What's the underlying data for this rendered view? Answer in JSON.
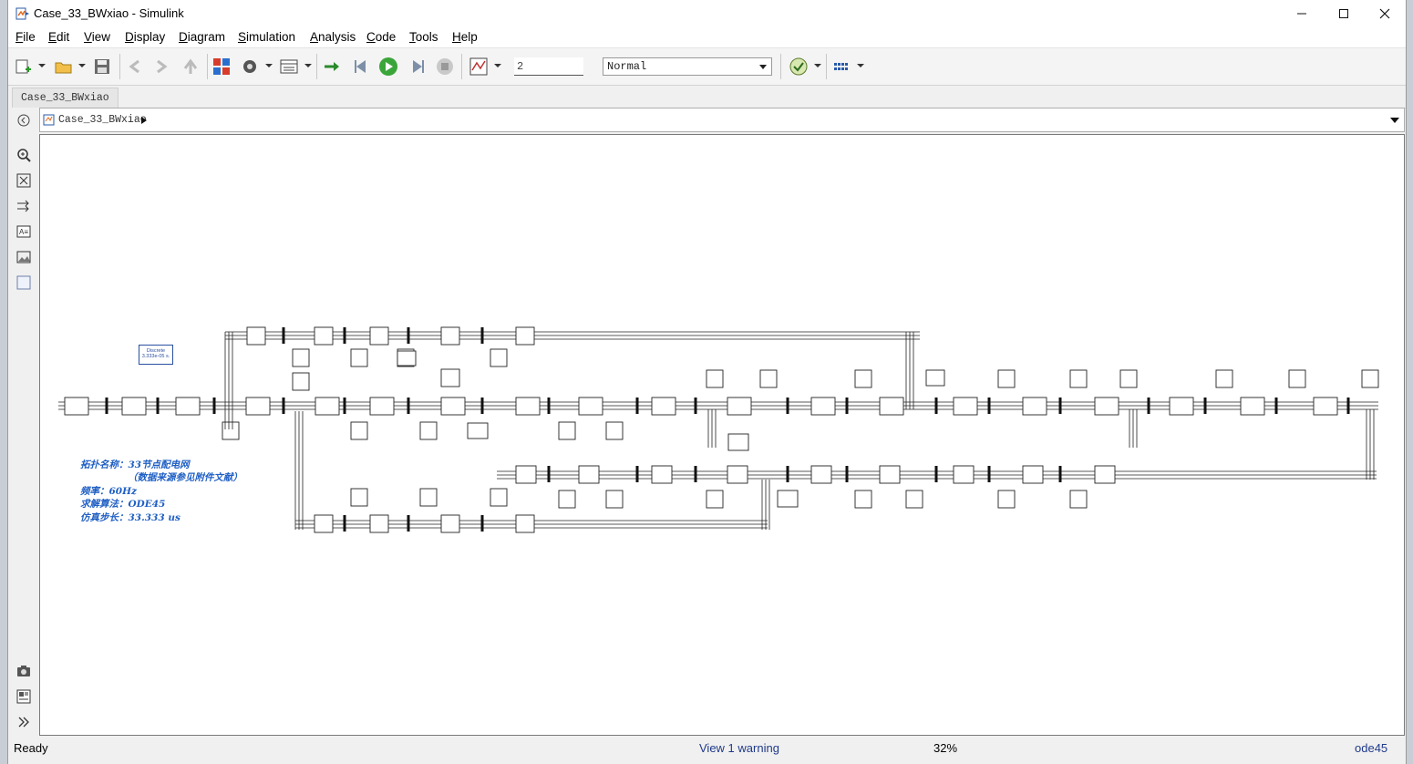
{
  "window": {
    "title": "Case_33_BWxiao - Simulink",
    "buttons": {
      "minimize": "—",
      "maximize": "☐",
      "close": "✕"
    }
  },
  "menu": {
    "items": [
      {
        "label": "File",
        "u": "F",
        "rest": "ile"
      },
      {
        "label": "Edit",
        "u": "E",
        "rest": "dit"
      },
      {
        "label": "View",
        "u": "V",
        "rest": "iew"
      },
      {
        "label": "Display",
        "u": "D",
        "rest": "isplay"
      },
      {
        "label": "Diagram",
        "u": "D",
        "rest": "iagram"
      },
      {
        "label": "Simulation",
        "u": "S",
        "rest": "imulation"
      },
      {
        "label": "Analysis",
        "u": "A",
        "rest": "nalysis"
      },
      {
        "label": "Code",
        "u": "C",
        "rest": "ode"
      },
      {
        "label": "Tools",
        "u": "T",
        "rest": "ools"
      },
      {
        "label": "Help",
        "u": "H",
        "rest": "elp"
      }
    ]
  },
  "toolbar": {
    "stop_time": "2",
    "sim_mode": "Normal"
  },
  "tabs": {
    "active": "Case_33_BWxiao"
  },
  "address": {
    "path": "Case_33_BWxiao"
  },
  "canvas": {
    "powergui": {
      "line1": "Discrete",
      "line2": "3.333e-05 s."
    },
    "annotation": {
      "line1": "拓扑名称：33节点配电网",
      "line2": "（数据来源参见附件文献）",
      "line3": "频率：60Hz",
      "line4": "求解算法：ODE45",
      "line5": "仿真步长：33.333 us"
    }
  },
  "status": {
    "ready": "Ready",
    "warning": "View 1 warning",
    "zoom": "32%",
    "solver": "ode45"
  }
}
